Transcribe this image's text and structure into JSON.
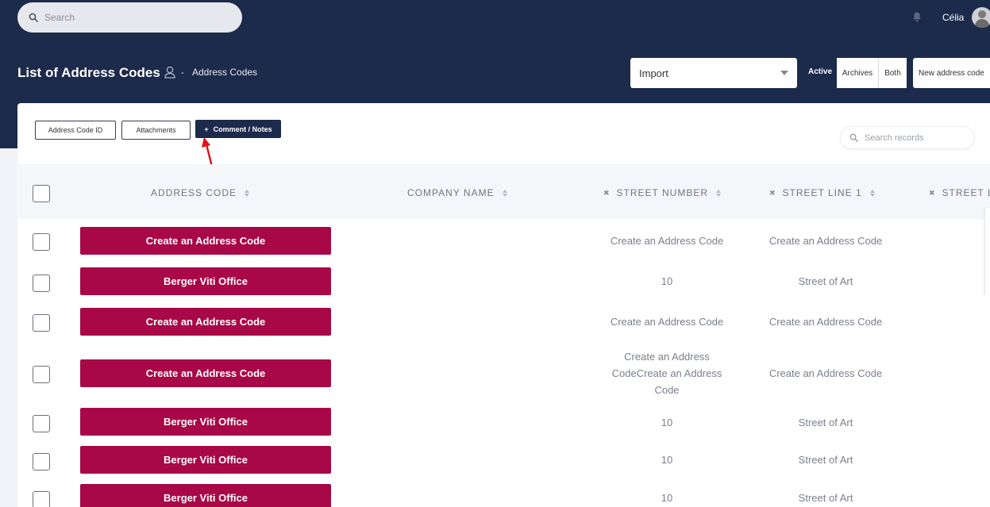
{
  "search": {
    "placeholder": "Search"
  },
  "user": {
    "name": "Célia"
  },
  "header": {
    "title": "List of Address Codes",
    "breadcrumb_sep": "-",
    "breadcrumb_current": "Address Codes"
  },
  "toolbar": {
    "import_value": "Import",
    "filter_active": "Active",
    "filter_archives": "Archives",
    "filter_both": "Both",
    "new_label": "New address code"
  },
  "columns_toggle": {
    "address_code_id": "Address Code ID",
    "attachments": "Attachments",
    "comment_notes": "Comment / Notes",
    "comment_plus": "+"
  },
  "records_search": {
    "placeholder": "Search records"
  },
  "table": {
    "headers": {
      "address_code": "ADDRESS CODE",
      "company_name": "COMPANY NAME",
      "street_number": "STREET NUMBER",
      "street_line_1": "STREET LINE 1",
      "street_line_2": "STREET LI"
    },
    "remove_icon": "✖",
    "rows": [
      {
        "code": "Create an Address Code",
        "company": "",
        "street_number": "Create an Address Code",
        "street_line_1": "Create an Address Code"
      },
      {
        "code": "Berger Viti Office",
        "company": "",
        "street_number": "10",
        "street_line_1": "Street of Art"
      },
      {
        "code": "Create an Address Code",
        "company": "",
        "street_number": "Create an Address Code",
        "street_line_1": "Create an Address Code"
      },
      {
        "code": "Create an Address Code",
        "company": "",
        "street_number": "Create an Address CodeCreate an Address Code",
        "street_line_1": "Create an Address Code"
      },
      {
        "code": "Berger Viti Office",
        "company": "",
        "street_number": "10",
        "street_line_1": "Street of Art"
      },
      {
        "code": "Berger Viti Office",
        "company": "",
        "street_number": "10",
        "street_line_1": "Street of Art"
      },
      {
        "code": "Berger Viti Office",
        "company": "",
        "street_number": "10",
        "street_line_1": "Street of Art"
      }
    ]
  },
  "colors": {
    "header_bg": "#1c2a4b",
    "accent_button": "#a80847",
    "annotation_arrow": "#e0101a"
  },
  "icons": [
    "search-icon",
    "bell-icon",
    "avatar",
    "user-icon",
    "chevron-down-icon",
    "plus-icon",
    "remove-icon",
    "sort-icon",
    "annotation-arrow"
  ]
}
